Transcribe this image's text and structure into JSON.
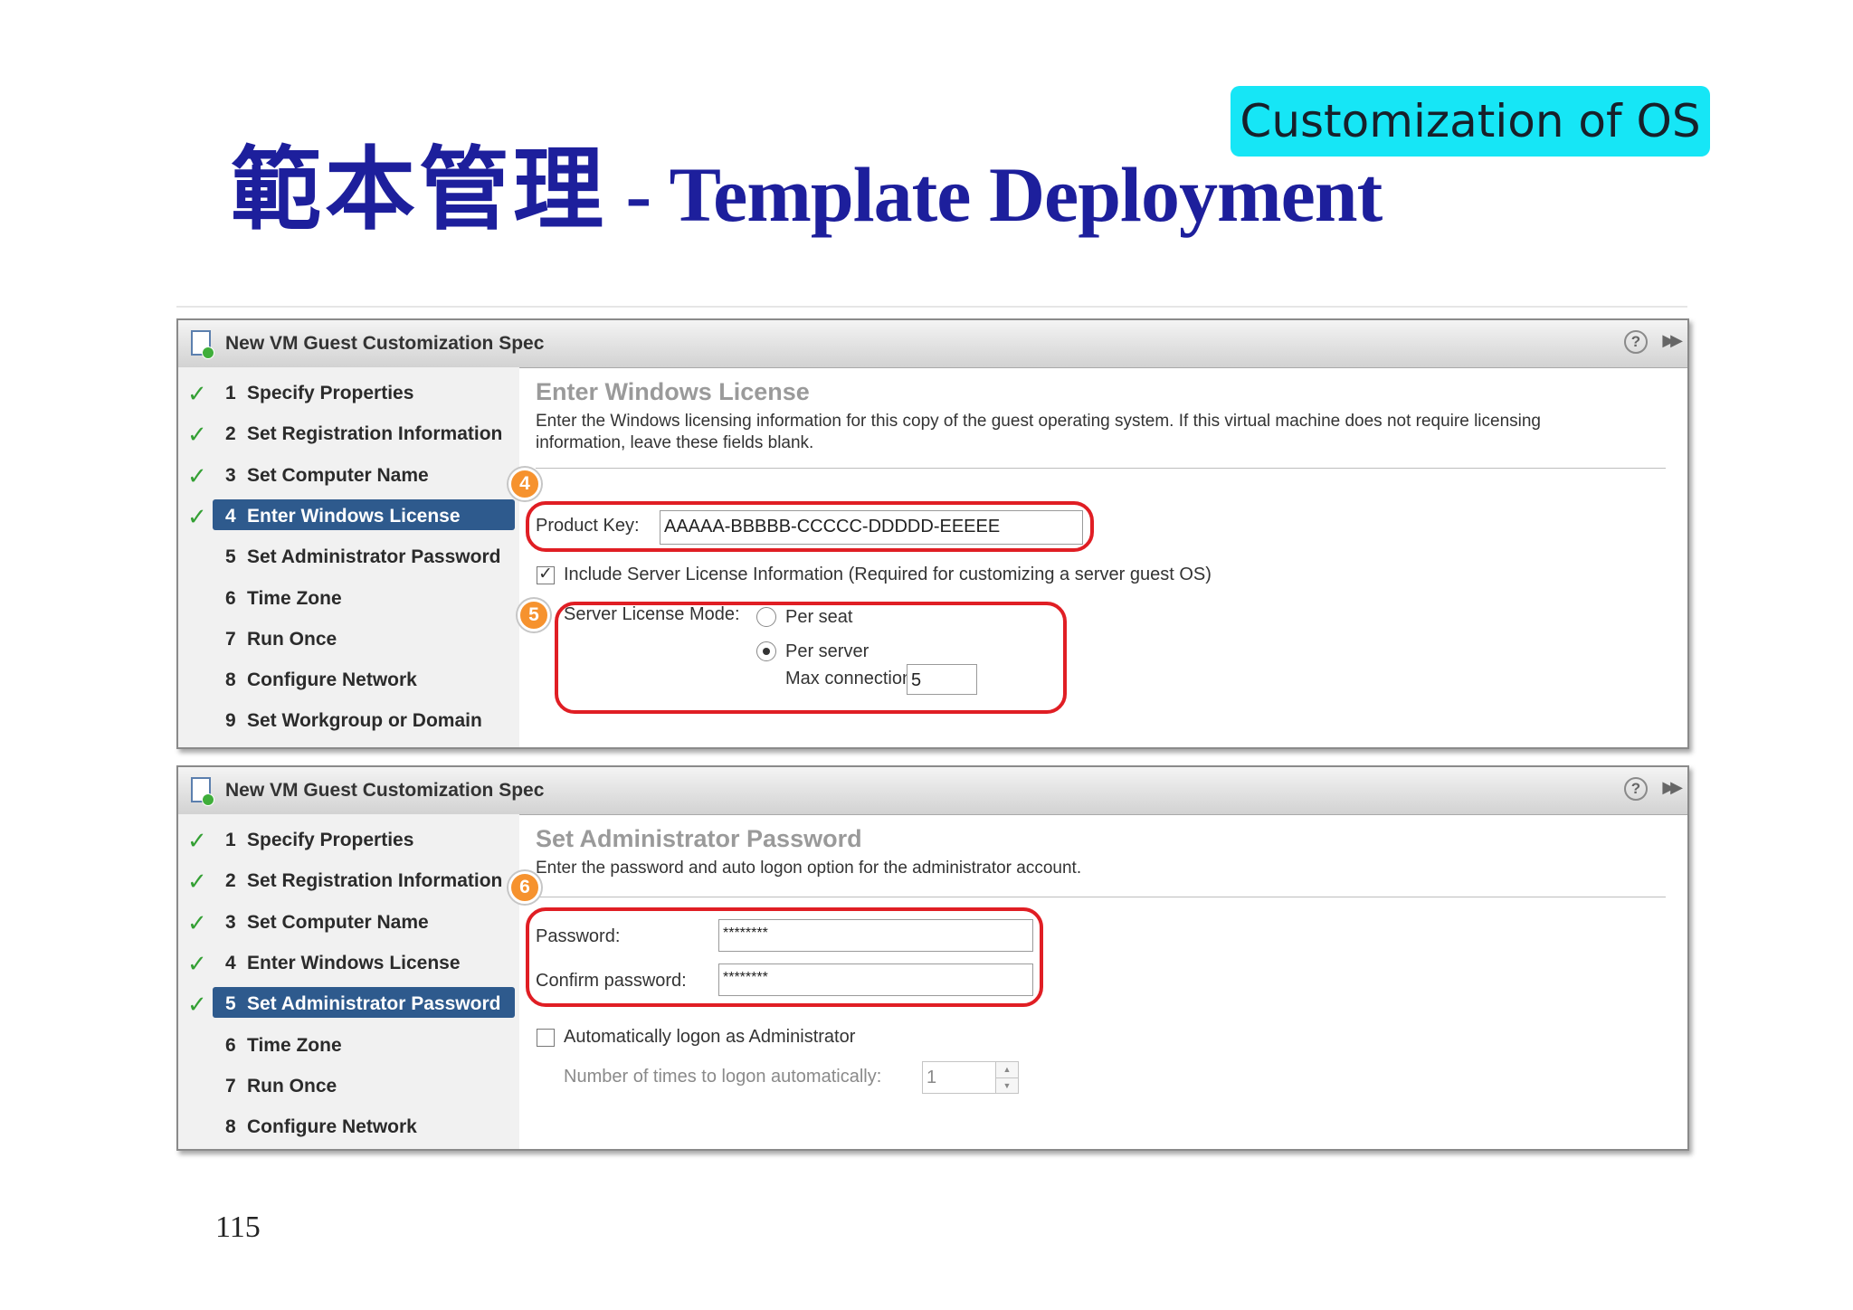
{
  "slide": {
    "title_cjk": "範本管理",
    "title_rest": " - Template Deployment",
    "badge": "Customization of OS",
    "page_number": "115",
    "colors": {
      "title": "#1d1f9c",
      "badge": "#16e6f6",
      "callout": "#e01e24",
      "marker": "#f6922e"
    }
  },
  "dialog1": {
    "title": "New VM Guest Customization Spec",
    "help_icon": "?",
    "expand_icon": "▶▶",
    "steps": [
      {
        "num": "1",
        "label": "Specify Properties",
        "done": true,
        "active": false
      },
      {
        "num": "2",
        "label": "Set Registration Information",
        "done": true,
        "active": false
      },
      {
        "num": "3",
        "label": "Set Computer Name",
        "done": true,
        "active": false
      },
      {
        "num": "4",
        "label": "Enter Windows License",
        "done": true,
        "active": true
      },
      {
        "num": "5",
        "label": "Set Administrator Password",
        "done": false,
        "active": false
      },
      {
        "num": "6",
        "label": "Time Zone",
        "done": false,
        "active": false
      },
      {
        "num": "7",
        "label": "Run Once",
        "done": false,
        "active": false
      },
      {
        "num": "8",
        "label": "Configure Network",
        "done": false,
        "active": false
      },
      {
        "num": "9",
        "label": "Set Workgroup or Domain",
        "done": false,
        "active": false
      }
    ],
    "heading": "Enter Windows License",
    "description": "Enter the Windows licensing information for this copy of the guest operating system. If this virtual machine does not require licensing information, leave these fields blank.",
    "marker_a": "4",
    "marker_b": "5",
    "product_key_label": "Product Key:",
    "product_key_value": "AAAAA-BBBBB-CCCCC-DDDDD-EEEEE",
    "server_license_checkbox_label": "Include Server License Information (Required for customizing a server guest OS)",
    "server_license_checked": true,
    "server_license_mode_label": "Server License Mode:",
    "per_seat_label": "Per seat",
    "per_server_label": "Per server",
    "selected_mode": "Per server",
    "max_connections_label": "Max connections:",
    "max_connections_value": "5"
  },
  "dialog2": {
    "title": "New VM Guest Customization Spec",
    "help_icon": "?",
    "expand_icon": "▶▶",
    "steps": [
      {
        "num": "1",
        "label": "Specify Properties",
        "done": true,
        "active": false
      },
      {
        "num": "2",
        "label": "Set Registration Information",
        "done": true,
        "active": false
      },
      {
        "num": "3",
        "label": "Set Computer Name",
        "done": true,
        "active": false
      },
      {
        "num": "4",
        "label": "Enter Windows License",
        "done": true,
        "active": false
      },
      {
        "num": "5",
        "label": "Set Administrator Password",
        "done": true,
        "active": true
      },
      {
        "num": "6",
        "label": "Time Zone",
        "done": false,
        "active": false
      },
      {
        "num": "7",
        "label": "Run Once",
        "done": false,
        "active": false
      },
      {
        "num": "8",
        "label": "Configure Network",
        "done": false,
        "active": false
      }
    ],
    "heading": "Set Administrator Password",
    "description": "Enter the password and auto logon option for the administrator account.",
    "marker": "6",
    "password_label": "Password:",
    "password_value": "********",
    "confirm_password_label": "Confirm password:",
    "confirm_password_value": "********",
    "auto_logon_label": "Automatically logon as Administrator",
    "auto_logon_checked": false,
    "logon_times_label": "Number of times to logon automatically:",
    "logon_times_value": "1"
  }
}
